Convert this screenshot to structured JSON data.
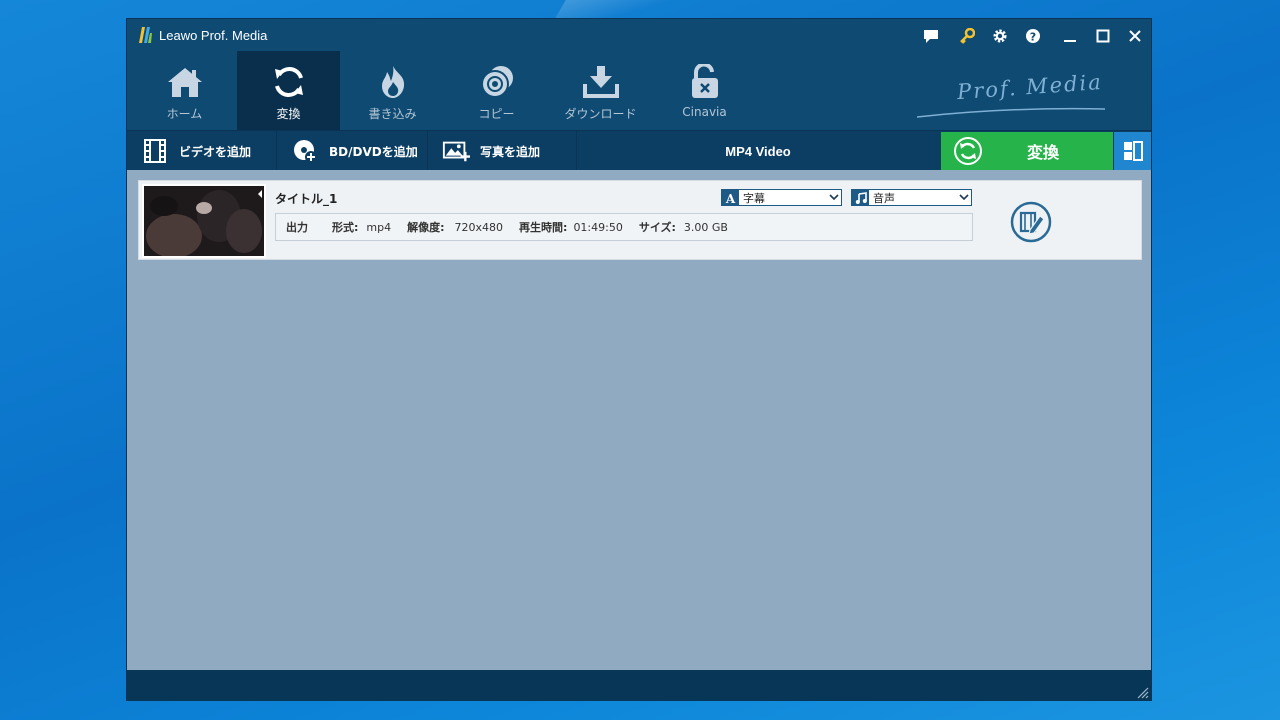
{
  "window": {
    "title": "Leawo Prof. Media"
  },
  "title_buttons": {
    "feedback": "feedback-icon",
    "register": "key-icon",
    "settings": "gear-icon",
    "help": "help-icon",
    "minimize": "minimize-icon",
    "maximize": "maximize-icon",
    "close": "close-icon"
  },
  "tabs": [
    {
      "label": "ホーム",
      "icon": "home-icon"
    },
    {
      "label": "変換",
      "icon": "convert-icon",
      "active": true
    },
    {
      "label": "書き込み",
      "icon": "burn-icon"
    },
    {
      "label": "コピー",
      "icon": "copy-disc-icon"
    },
    {
      "label": "ダウンロード",
      "icon": "download-icon"
    },
    {
      "label": "Cinavia",
      "icon": "unlock-icon"
    }
  ],
  "brand": {
    "text": "Prof. Media"
  },
  "actions": {
    "add_video": "ビデオを追加",
    "add_disc": "BD/DVDを追加",
    "add_photo": "写真を追加",
    "format": "MP4 Video",
    "convert": "変換"
  },
  "file": {
    "title": "タイトル_1",
    "subtitle_select": "字幕",
    "audio_select": "音声",
    "output_label": "出力",
    "format_label": "形式:",
    "format_value": "mp4",
    "resolution_label": "解像度:",
    "resolution_value": "720x480",
    "duration_label": "再生時間:",
    "duration_value": "01:49:50",
    "size_label": "サイズ:",
    "size_value": "3.00 GB"
  },
  "colors": {
    "accent_green": "#26b34a",
    "panel_blue": "#1f86cf",
    "title_bg": "#0f4a73",
    "content_bg": "#90abc1"
  }
}
